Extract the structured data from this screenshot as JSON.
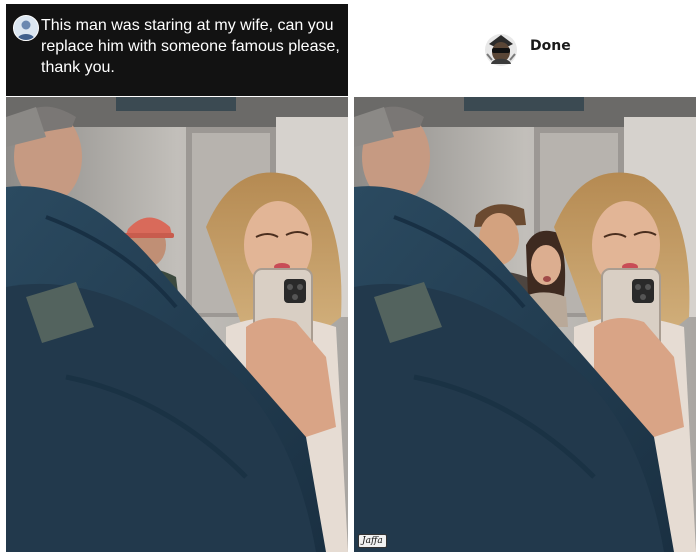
{
  "request": {
    "text": "This man was staring at my wife, can you replace him with someone famous please, thank you."
  },
  "reply": {
    "status": "Done"
  },
  "photo_right": {
    "watermark": "Jaffa"
  }
}
